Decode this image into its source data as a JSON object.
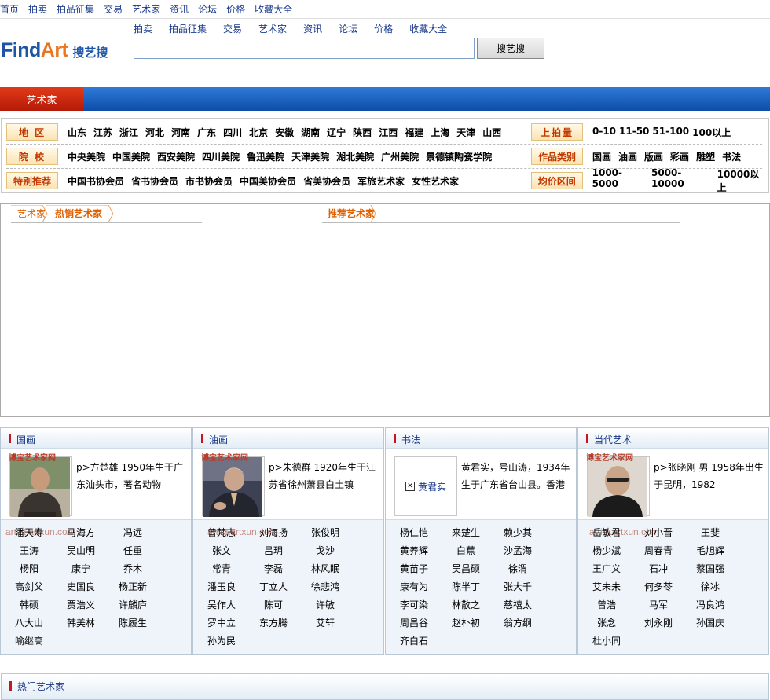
{
  "topnav": [
    "首页",
    "拍卖",
    "拍品征集",
    "交易",
    "艺术家",
    "资讯",
    "论坛",
    "价格",
    "收藏大全"
  ],
  "logo": {
    "find": "Find",
    "art": "Art",
    "cn": "搜艺搜"
  },
  "subnav": [
    "拍卖",
    "拍品征集",
    "交易",
    "艺术家",
    "资讯",
    "论坛",
    "价格",
    "收藏大全"
  ],
  "search": {
    "value": "",
    "button": "搜艺搜"
  },
  "section_tab": "艺术家",
  "filters": {
    "region_label": "地 区",
    "regions": [
      "山东",
      "江苏",
      "浙江",
      "河北",
      "河南",
      "广东",
      "四川",
      "北京",
      "安徽",
      "湖南",
      "辽宁",
      "陕西",
      "江西",
      "福建",
      "上海",
      "天津",
      "山西"
    ],
    "school_label": "院 校",
    "schools": [
      "中央美院",
      "中国美院",
      "西安美院",
      "四川美院",
      "鲁迅美院",
      "天津美院",
      "湖北美院",
      "广州美院",
      "景德镇陶瓷学院"
    ],
    "special_label": "特别推荐",
    "specials": [
      "中国书协会员",
      "省书协会员",
      "市书协会员",
      "中国美协会员",
      "省美协会员",
      "军旅艺术家",
      "女性艺术家"
    ],
    "auction_label": "上拍量",
    "auctions": [
      "0-10",
      "11-50",
      "51-100",
      "100以上"
    ],
    "category_label": "作品类别",
    "categories": [
      "国画",
      "油画",
      "版画",
      "彩画",
      "雕塑",
      "书法"
    ],
    "price_label": "均价区间",
    "prices": [
      "1000-5000",
      "5000-10000",
      "10000以上"
    ]
  },
  "panels": {
    "left_title_a": "艺术家",
    "left_title_b": "热销艺术家",
    "right_title": "推荐艺术家"
  },
  "watermark": {
    "cn": "博宝艺术家网",
    "url": "artist.artxun.com"
  },
  "categories_blocks": [
    {
      "title": "国画",
      "feature_text": "p>方楚雄  1950年生于广东汕头市，著名动物",
      "names": [
        "潘天寿",
        "马海方",
        "冯远",
        "王涛",
        "吴山明",
        "任重",
        "杨阳",
        "康宁",
        "乔木",
        "高剑父",
        "史国良",
        "杨正新",
        "韩硕",
        "贾浩义",
        "许麟庐",
        "八大山",
        "韩美林",
        "陈履生",
        "喻继高"
      ]
    },
    {
      "title": "油画",
      "feature_text": "p>朱德群  1920年生于江苏省徐州萧县白土镇",
      "names": [
        "曾梵志",
        "刘海扬",
        "张俊明",
        "张文",
        "吕玥",
        "戈沙",
        "常青",
        "李磊",
        "林风眠",
        "潘玉良",
        "丁立人",
        "徐悲鸿",
        "吴作人",
        "陈可",
        "许敏",
        "罗中立",
        "东方腾",
        "艾轩",
        "孙为民"
      ]
    },
    {
      "title": "书法",
      "feature_image_label": "黄君实",
      "feature_text": "黄君实，号山涛，1934年生于广东省台山县。香港",
      "names": [
        "杨仁恺",
        "来楚生",
        "赖少其",
        "黄养辉",
        "白蕉",
        "沙孟海",
        "黄苗子",
        "吴昌硕",
        "徐渭",
        "康有为",
        "陈半丁",
        "张大千",
        "李可染",
        "林散之",
        "慈禧太",
        "周昌谷",
        "赵朴初",
        "翁方纲",
        "齐白石"
      ]
    },
    {
      "title": "当代艺术",
      "feature_text": "p>张晓刚  男  1958年出生于昆明，1982",
      "names": [
        "岳敏君",
        "刘小晋",
        "王斐",
        "杨少斌",
        "周春青",
        "毛旭辉",
        "王广义",
        "石冲",
        "蔡国强",
        "艾未未",
        "何多苓",
        "徐冰",
        "曾浩",
        "马军",
        "冯良鸿",
        "张念",
        "刘永刚",
        "孙国庆",
        "杜小同"
      ]
    }
  ],
  "hot_title": "热门艺术家"
}
